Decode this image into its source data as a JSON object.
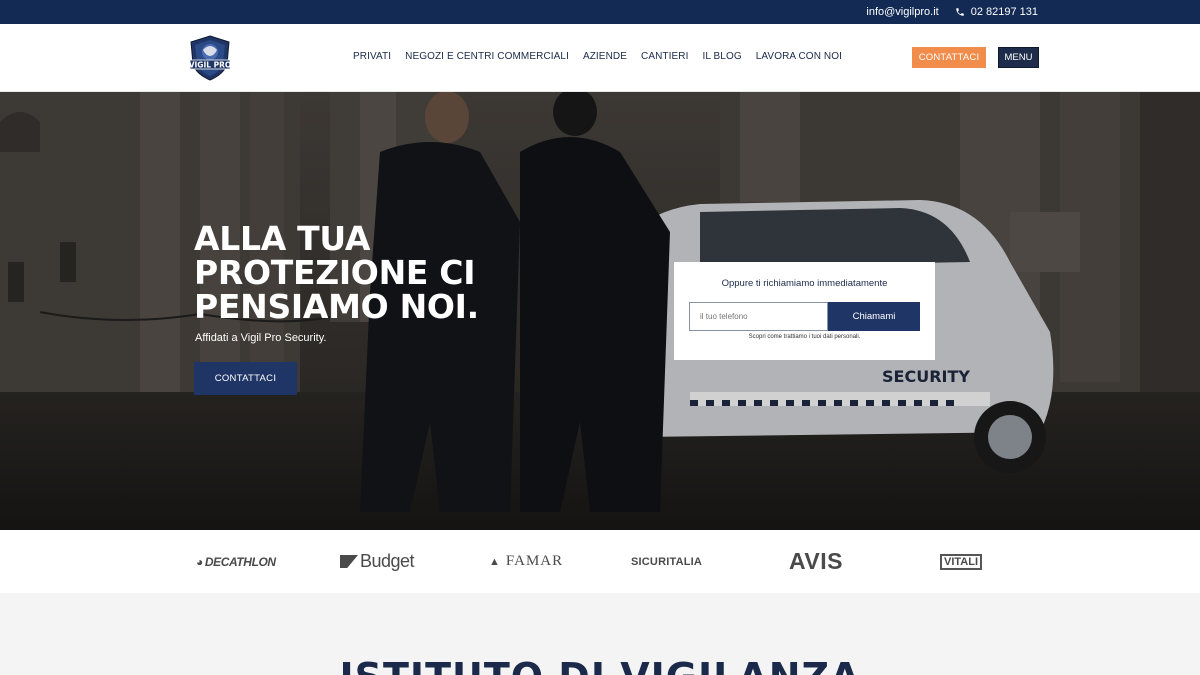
{
  "topbar": {
    "email": "info@vigilpro.it",
    "phone": "02 82197 131"
  },
  "header": {
    "logo_alt": "Vigil Pro Security",
    "nav": [
      {
        "label": "PRIVATI"
      },
      {
        "label": "NEGOZI E CENTRI COMMERCIALI"
      },
      {
        "label": "AZIENDE"
      },
      {
        "label": "CANTIERI"
      },
      {
        "label": "IL BLOG"
      },
      {
        "label": "LAVORA CON NOI"
      }
    ],
    "contact_label": "CONTATTACI",
    "menu_label": "MENU"
  },
  "hero": {
    "title_lines": [
      "ALLA TUA",
      "PROTEZIONE CI",
      "PENSIAMO NOI."
    ],
    "subtitle": "Affidati a Vigil Pro Security.",
    "cta_label": "CONTATTACI",
    "car_text": "SECURITY",
    "callbox": {
      "title": "Oppure ti richiamiamo immediatamente",
      "input_placeholder": "il tuo telefono",
      "button_label": "Chiamami",
      "privacy_note": "Scopri come trattiamo i tuoi dati personali."
    }
  },
  "brands": [
    "DECATHLON",
    "Budget",
    "FAMAR",
    "SICURITALIA",
    "AVIS",
    "VITALI"
  ],
  "section2": {
    "title": "ISTITUTO DI VIGILANZA"
  },
  "colors": {
    "navy": "#122a54",
    "button_navy": "#1f3566",
    "orange": "#f28c4b"
  }
}
